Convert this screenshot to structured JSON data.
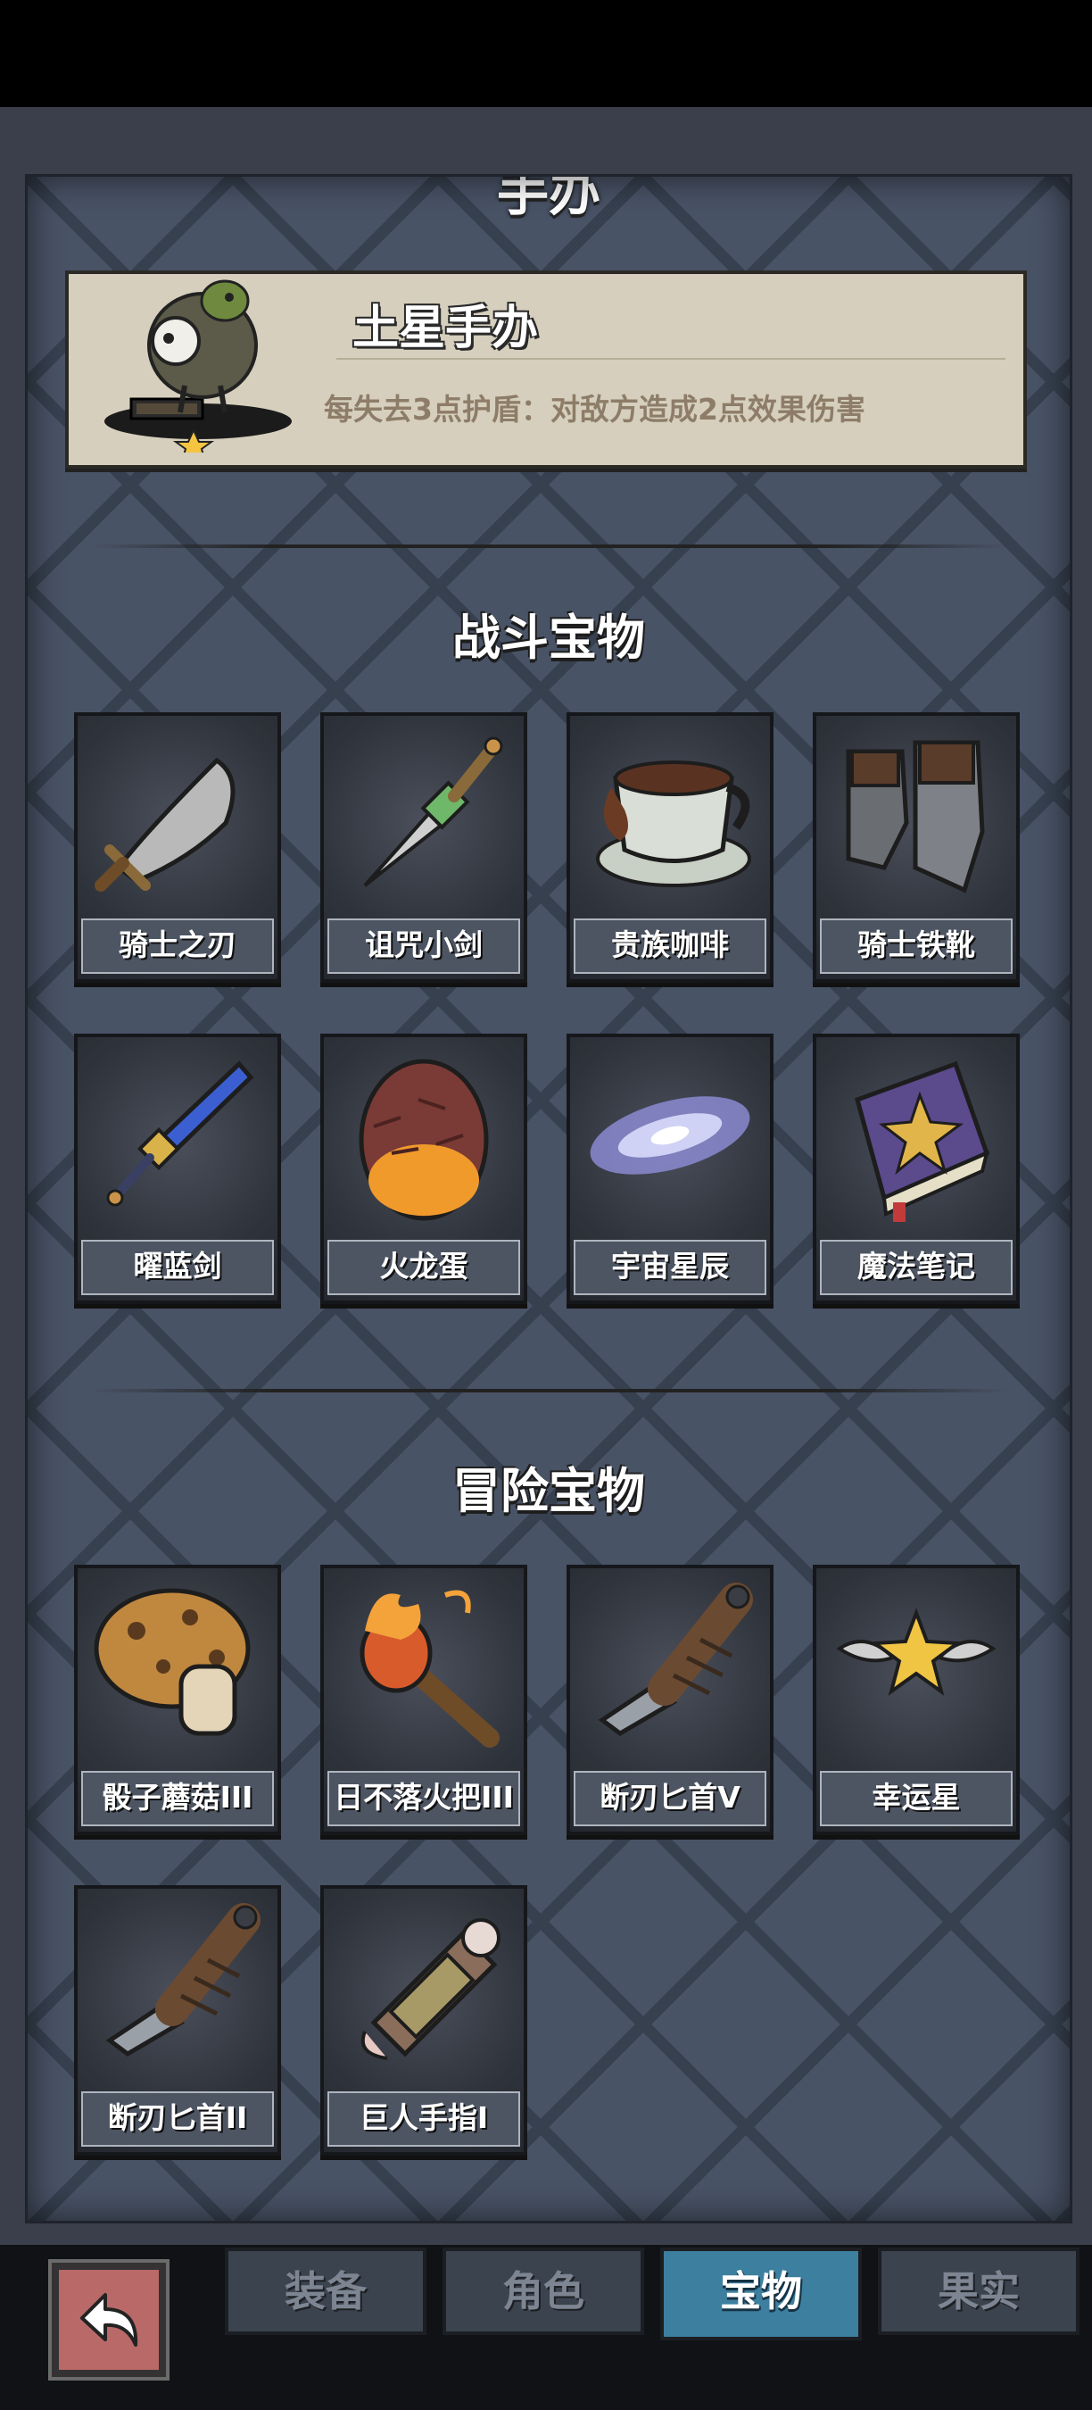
{
  "header": {
    "section_cut_title": "手办"
  },
  "figurine": {
    "name": "土星手办",
    "description": "每失去3点护盾：对敌方造成2点效果伤害",
    "icon": "saturn-figurine-icon"
  },
  "combat_section": {
    "title": "战斗宝物",
    "items": [
      {
        "label": "骑士之刃",
        "icon": "blade-icon"
      },
      {
        "label": "诅咒小剑",
        "icon": "dagger-icon"
      },
      {
        "label": "贵族咖啡",
        "icon": "coffee-cup-icon"
      },
      {
        "label": "骑士铁靴",
        "icon": "iron-boots-icon"
      },
      {
        "label": "曜蓝剑",
        "icon": "blue-sword-icon"
      },
      {
        "label": "火龙蛋",
        "icon": "dragon-egg-icon"
      },
      {
        "label": "宇宙星辰",
        "icon": "galaxy-icon"
      },
      {
        "label": "魔法笔记",
        "icon": "spellbook-icon"
      }
    ]
  },
  "adventure_section": {
    "title": "冒险宝物",
    "items": [
      {
        "label": "骰子蘑菇III",
        "icon": "mushroom-icon"
      },
      {
        "label": "日不落火把III",
        "icon": "torch-icon"
      },
      {
        "label": "断刃匕首V",
        "icon": "broken-dagger-icon"
      },
      {
        "label": "幸运星",
        "icon": "lucky-star-icon"
      },
      {
        "label": "断刃匕首II",
        "icon": "broken-dagger-icon"
      },
      {
        "label": "巨人手指I",
        "icon": "giant-finger-icon"
      }
    ]
  },
  "tabs": [
    {
      "label": "装备",
      "active": false
    },
    {
      "label": "角色",
      "active": false
    },
    {
      "label": "宝物",
      "active": true
    },
    {
      "label": "果实",
      "active": false
    }
  ],
  "colors": {
    "accent_tab": "#3d7f9f",
    "back_button": "#b86968",
    "panel": "#495366"
  }
}
